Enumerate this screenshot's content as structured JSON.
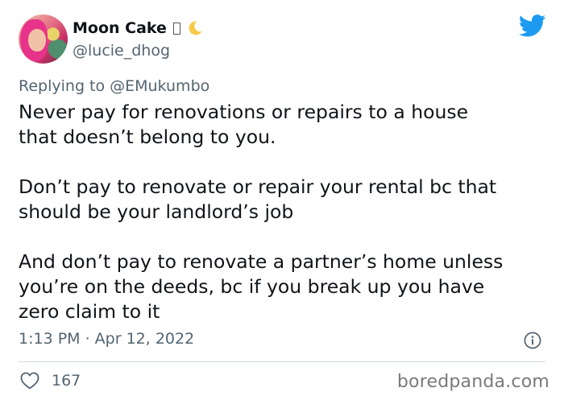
{
  "tweet": {
    "author": {
      "display_name": "Moon Cake",
      "handle": "@lucie_dhog"
    },
    "reply": {
      "prefix": "Replying to ",
      "mention": "@EMukumbo"
    },
    "paragraphs": [
      {
        "lines": [
          "Never pay for renovations or repairs to a house",
          "that doesn’t belong to you."
        ]
      },
      {
        "lines": [
          "Don’t pay to renovate or repair your rental bc that",
          "should be your landlord’s job"
        ]
      },
      {
        "lines": [
          "And don’t pay to renovate a partner’s home unless",
          "you’re on the deeds, bc if you break up you have",
          "zero claim to it"
        ]
      }
    ],
    "timestamp": "1:13 PM · Apr 12, 2022",
    "likes": "167"
  },
  "watermark": "boredpanda.com",
  "icons": {
    "brand": "twitter-bird-icon",
    "emoji": "crescent-moon-icon",
    "info": "info-icon",
    "like": "heart-icon"
  },
  "colors": {
    "twitter_blue": "#1d9bf0",
    "secondary_text": "#536471",
    "primary_text": "#0f1419",
    "moon_yellow": "#f7c948"
  }
}
